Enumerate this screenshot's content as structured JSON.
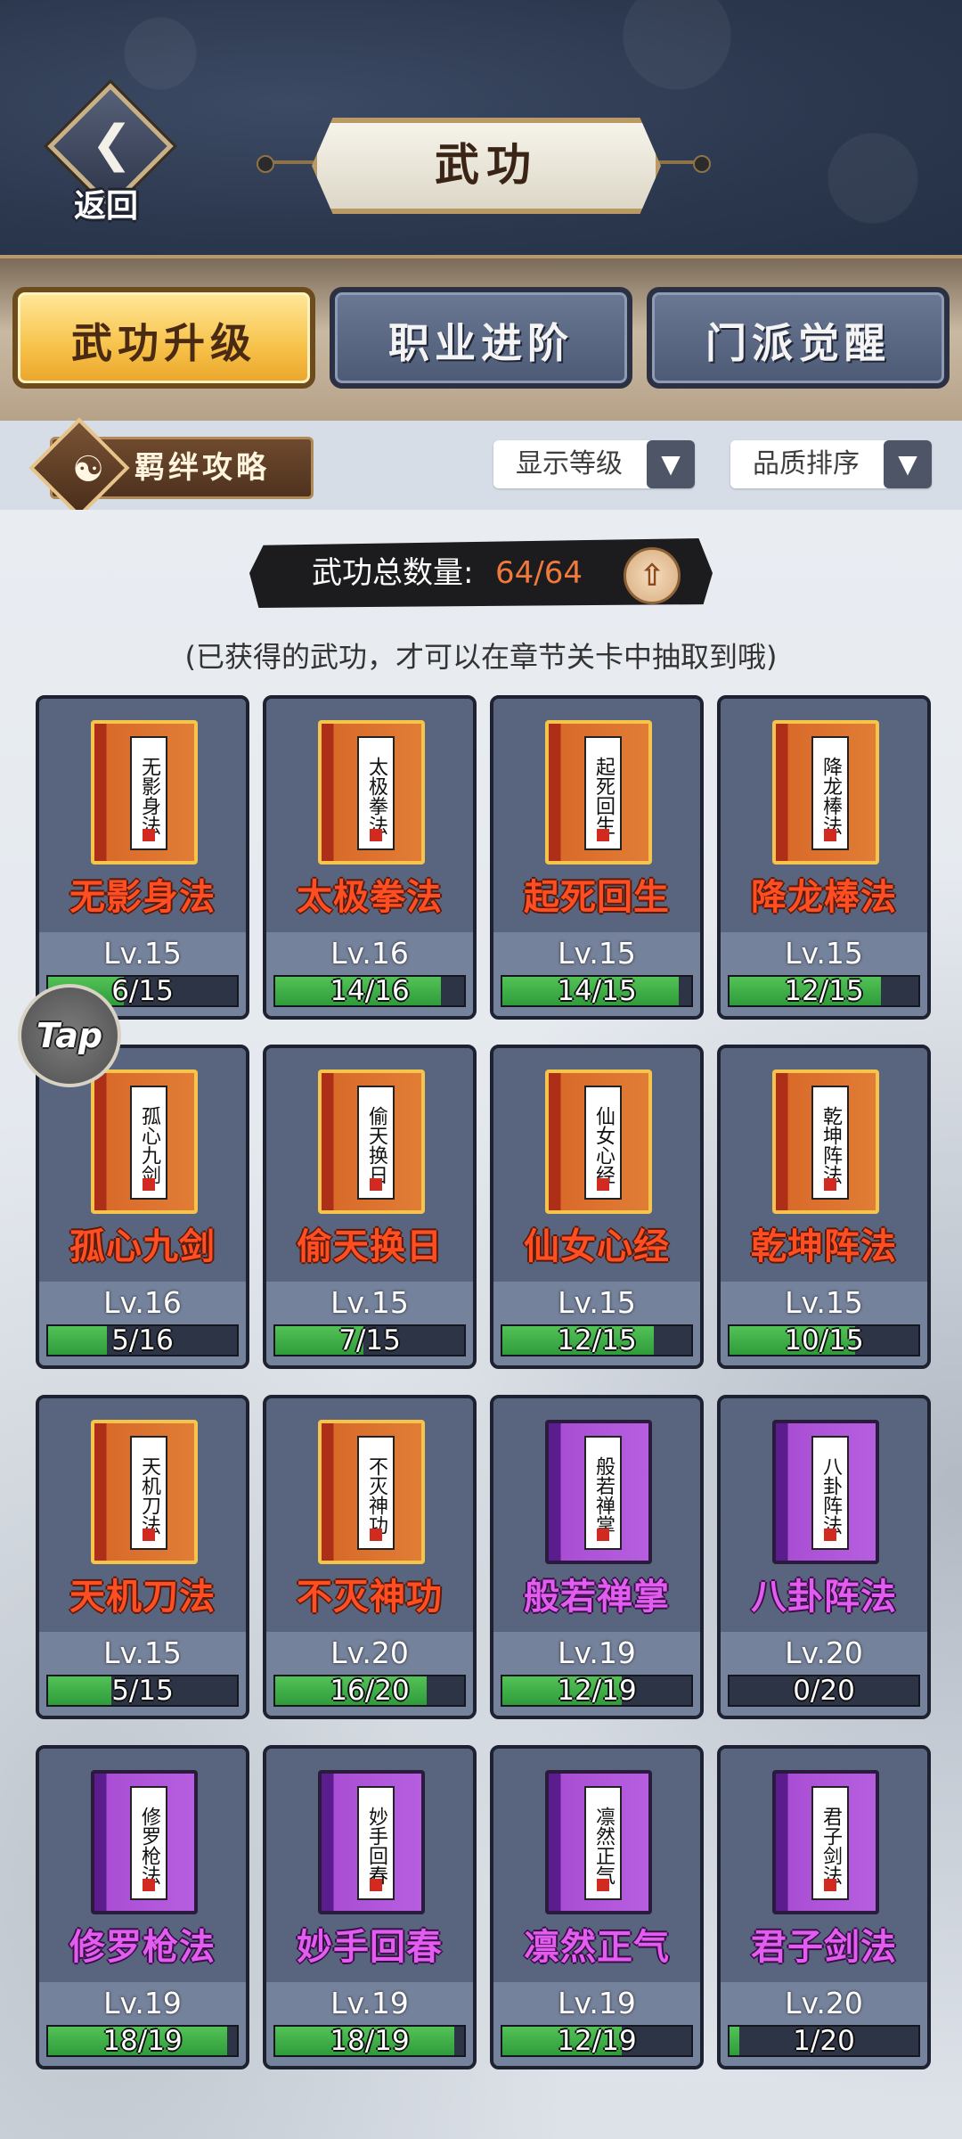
{
  "header": {
    "back_label": "返回",
    "title": "武功"
  },
  "tabs": [
    {
      "label": "武功升级",
      "active": true
    },
    {
      "label": "职业进阶",
      "active": false
    },
    {
      "label": "门派觉醒",
      "active": false
    }
  ],
  "filters": {
    "guide_label": "羁绊攻略",
    "level_dropdown": "显示等级",
    "quality_dropdown": "品质排序"
  },
  "summary": {
    "label": "武功总数量:",
    "value": "64/64"
  },
  "hint": "(已获得的武功，才可以在章节关卡中抽取到哦)",
  "floating": {
    "tap_label": "Tap"
  },
  "colors": {
    "orange_name": "#ff4e22",
    "purple_name": "#e35cf0",
    "progress_green": "#3fae45",
    "active_tab": "#f7c24a"
  },
  "skills": [
    {
      "name": "无影身法",
      "quality": "orange",
      "level": "Lv.15",
      "progress": "6/15",
      "fraction": 0.4
    },
    {
      "name": "太极拳法",
      "quality": "orange",
      "level": "Lv.16",
      "progress": "14/16",
      "fraction": 0.875
    },
    {
      "name": "起死回生",
      "quality": "orange",
      "level": "Lv.15",
      "progress": "14/15",
      "fraction": 0.933
    },
    {
      "name": "降龙棒法",
      "quality": "orange",
      "level": "Lv.15",
      "progress": "12/15",
      "fraction": 0.8
    },
    {
      "name": "孤心九剑",
      "quality": "orange",
      "level": "Lv.16",
      "progress": "5/16",
      "fraction": 0.3125
    },
    {
      "name": "偷天换日",
      "quality": "orange",
      "level": "Lv.15",
      "progress": "7/15",
      "fraction": 0.467
    },
    {
      "name": "仙女心经",
      "quality": "orange",
      "level": "Lv.15",
      "progress": "12/15",
      "fraction": 0.8
    },
    {
      "name": "乾坤阵法",
      "quality": "orange",
      "level": "Lv.15",
      "progress": "10/15",
      "fraction": 0.667
    },
    {
      "name": "天机刀法",
      "quality": "orange",
      "level": "Lv.15",
      "progress": "5/15",
      "fraction": 0.333
    },
    {
      "name": "不灭神功",
      "quality": "orange",
      "level": "Lv.20",
      "progress": "16/20",
      "fraction": 0.8
    },
    {
      "name": "般若禅掌",
      "quality": "purple",
      "level": "Lv.19",
      "progress": "12/19",
      "fraction": 0.632
    },
    {
      "name": "八卦阵法",
      "quality": "purple",
      "level": "Lv.20",
      "progress": "0/20",
      "fraction": 0.0
    },
    {
      "name": "修罗枪法",
      "quality": "purple",
      "level": "Lv.19",
      "progress": "18/19",
      "fraction": 0.947
    },
    {
      "name": "妙手回春",
      "quality": "purple",
      "level": "Lv.19",
      "progress": "18/19",
      "fraction": 0.947
    },
    {
      "name": "凛然正气",
      "quality": "purple",
      "level": "Lv.19",
      "progress": "12/19",
      "fraction": 0.632
    },
    {
      "name": "君子剑法",
      "quality": "purple",
      "level": "Lv.20",
      "progress": "1/20",
      "fraction": 0.05
    }
  ]
}
